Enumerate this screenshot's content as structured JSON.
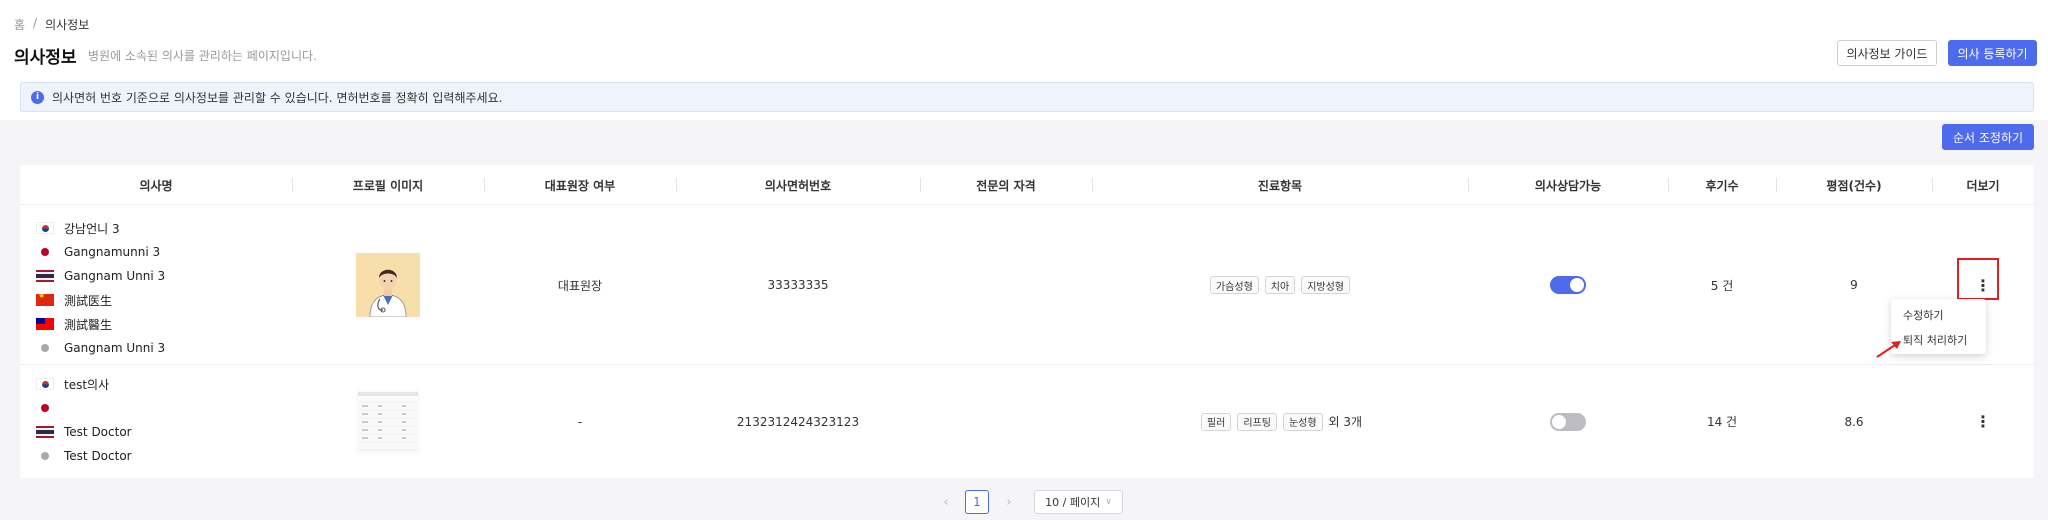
{
  "breadcrumb": {
    "home": "홈",
    "separator": "/",
    "current": "의사정보"
  },
  "header": {
    "title": "의사정보",
    "description": "병원에 소속된 의사를 관리하는 페이지입니다.",
    "guide_button": "의사정보 가이드",
    "register_button": "의사 등록하기"
  },
  "info": {
    "icon": "info-icon",
    "text": "의사면허 번호 기준으로 의사정보를 관리할 수 있습니다. 면허번호를 정확히 입력해주세요."
  },
  "reorder_button": "순서 조정하기",
  "table": {
    "columns": [
      "의사명",
      "프로필 이미지",
      "대표원장 여부",
      "의사면허번호",
      "전문의 자격",
      "진료항목",
      "의사상담가능",
      "후기수",
      "평점(건수)",
      "더보기"
    ],
    "rows": [
      {
        "names": [
          {
            "flag": "kr",
            "text": "강남언니 3"
          },
          {
            "flag": "jp",
            "text": "Gangnamunni 3"
          },
          {
            "flag": "th",
            "text": "Gangnam Unni 3"
          },
          {
            "flag": "cn",
            "text": "測試医生"
          },
          {
            "flag": "tw",
            "text": "測試醫生"
          },
          {
            "flag": "gray",
            "text": "Gangnam Unni 3"
          }
        ],
        "profile_image": "doctor-avatar",
        "representative": "대표원장",
        "license": "33333335",
        "specialist": "",
        "treatments": [
          "가슴성형",
          "치아",
          "지방성형"
        ],
        "treatments_more": "",
        "consult": true,
        "reviews": "5 건",
        "rating": "9"
      },
      {
        "names": [
          {
            "flag": "kr",
            "text": "test의사"
          },
          {
            "flag": "jp",
            "text": ""
          },
          {
            "flag": "th",
            "text": "Test Doctor"
          },
          {
            "flag": "gray",
            "text": "Test Doctor"
          }
        ],
        "profile_image": "document-thumbnail",
        "representative": "-",
        "license": "2132312424323123",
        "specialist": "",
        "treatments": [
          "필러",
          "리프팅",
          "눈성형"
        ],
        "treatments_more": "외 3개",
        "consult": false,
        "reviews": "14 건",
        "rating": "8.6"
      }
    ]
  },
  "more_menu": {
    "edit": "수정하기",
    "retire": "퇴직 처리하기"
  },
  "pagination": {
    "current": "1",
    "prev_icon": "chevron-left-icon",
    "next_icon": "chevron-right-icon",
    "page_size": "10 / 페이지"
  },
  "colors": {
    "primary": "#4f6bed",
    "highlight": "#e02020",
    "toggle_off": "#bcbcc2"
  }
}
